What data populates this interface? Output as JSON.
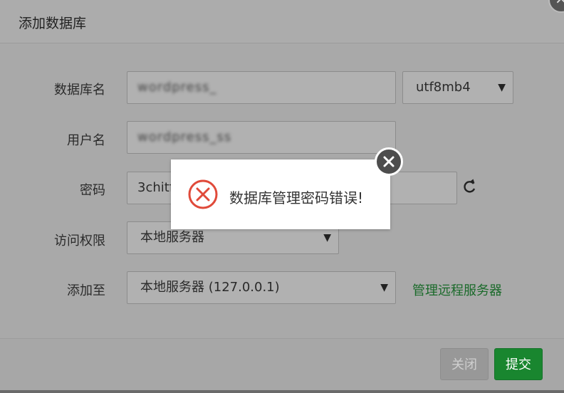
{
  "dialog": {
    "title": "添加数据库",
    "close_glyph": "×"
  },
  "form": {
    "db_name": {
      "label": "数据库名",
      "value": "wordpress_"
    },
    "charset": {
      "value": "utf8mb4",
      "arrow": "▼"
    },
    "username": {
      "label": "用户名",
      "value": "wordpress_ss"
    },
    "password": {
      "label": "密码",
      "value": "3chitf"
    },
    "access": {
      "label": "访问权限",
      "value": "本地服务器",
      "arrow": "▼"
    },
    "add_to": {
      "label": "添加至",
      "value": "本地服务器 (127.0.0.1)",
      "arrow": "▼"
    },
    "manage_remote_link": "管理远程服务器"
  },
  "footer": {
    "close_label": "关闭",
    "submit_label": "提交"
  },
  "toast": {
    "message": "数据库管理密码错误!",
    "icon": "error-circle-x-icon",
    "close_icon": "close-circle-icon"
  },
  "colors": {
    "overlay": "#a9a9a9",
    "submit": "#19862f",
    "link": "#1a6a2a",
    "error": "#e04a3a"
  }
}
